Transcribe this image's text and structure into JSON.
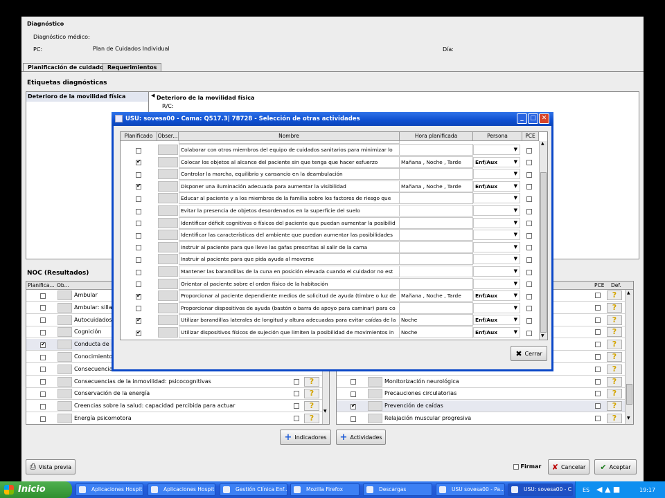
{
  "header": {
    "section_title": "Diagnóstico",
    "diag_medico_label": "Diagnóstico médico:",
    "pc_label": "PC:",
    "pc_value": "Plan de Cuidados Individual",
    "dia_label": "Día:"
  },
  "tabs": [
    "Planificación de cuidados",
    "Requerimientos"
  ],
  "etiquetas": {
    "title": "Etiquetas diagnósticas",
    "list_item": "Deterioro de la movilidad física",
    "detail_title": "Deterioro de la movilidad física",
    "detail_rc": "R/C:"
  },
  "noc": {
    "title": "NOC (Resultados)",
    "headers": [
      "Planifica...",
      "Ob..."
    ],
    "rows": [
      {
        "checked": false,
        "name": "Ambular"
      },
      {
        "checked": false,
        "name": "Ambular: silla d"
      },
      {
        "checked": false,
        "name": "Autocuidados:"
      },
      {
        "checked": false,
        "name": "Cognición"
      },
      {
        "checked": true,
        "name": "Conducta de p"
      },
      {
        "checked": false,
        "name": "Conocimiento:"
      },
      {
        "checked": false,
        "name": "Consecuencia"
      },
      {
        "checked": false,
        "name": "Consecuencias de la inmovilidad: psicocognitivas"
      },
      {
        "checked": false,
        "name": "Conservación de la energía"
      },
      {
        "checked": false,
        "name": "Creencias sobre la salud: capacidad percibida para actuar"
      },
      {
        "checked": false,
        "name": "Energía psicomotora"
      }
    ]
  },
  "nic": {
    "headers": [
      "PCE",
      "Def."
    ],
    "rows": [
      {
        "checked": false,
        "name": "Monitorización neurológica"
      },
      {
        "checked": false,
        "name": "Precauciones circulatorias"
      },
      {
        "checked": true,
        "name": "Prevención de caídas"
      },
      {
        "checked": false,
        "name": "Relajación muscular progresiva"
      }
    ]
  },
  "buttons": {
    "indicadores": "Indicadores",
    "actividades": "Actividades",
    "vista_previa": "Vista previa",
    "firmar": "Firmar",
    "cancelar": "Cancelar",
    "aceptar": "Aceptar"
  },
  "dialog": {
    "title": "USU: sovesa00 - Cama: Q517.3| 78728 - Selección de otras actividades",
    "headers": [
      "Planificado",
      "Obser...",
      "Nombre",
      "Hora planificada",
      "Persona",
      "PCE"
    ],
    "rows": [
      {
        "checked": false,
        "name": "Colaborar con otros miembros del equipo de cuidados sanitarios para minimizar lo",
        "hora": "",
        "persona": ""
      },
      {
        "checked": true,
        "name": "Colocar los objetos al alcance del paciente sin que tenga que hacer esfuerzo",
        "hora": "Mañana , Noche , Tarde",
        "persona": "Enf/Aux"
      },
      {
        "checked": false,
        "name": "Controlar la marcha, equilibrio y cansancio en la deambulación",
        "hora": "",
        "persona": ""
      },
      {
        "checked": true,
        "name": "Disponer una iluminación adecuada para aumentar la visibilidad",
        "hora": "Mañana , Noche , Tarde",
        "persona": "Enf/Aux"
      },
      {
        "checked": false,
        "name": "Educar al paciente y a los miembros de la familia sobre los factores de riesgo que",
        "hora": "",
        "persona": ""
      },
      {
        "checked": false,
        "name": "Evitar la presencia de objetos desordenados en la superficie del suelo",
        "hora": "",
        "persona": ""
      },
      {
        "checked": false,
        "name": "Identificar déficit cognitivos o físicos del paciente que puedan aumentar la posibilid",
        "hora": "",
        "persona": ""
      },
      {
        "checked": false,
        "name": "Identificar las características del ambiente que puedan aumentar las posibilidades",
        "hora": "",
        "persona": ""
      },
      {
        "checked": false,
        "name": "Instruir al paciente para que lleve las gafas prescritas al salir de la cama",
        "hora": "",
        "persona": ""
      },
      {
        "checked": false,
        "name": "Instruir al paciente para que pida ayuda al moverse",
        "hora": "",
        "persona": ""
      },
      {
        "checked": false,
        "name": "Mantener las barandillas de la cuna en posición elevada cuando el cuidador no est",
        "hora": "",
        "persona": ""
      },
      {
        "checked": false,
        "name": "Orientar al paciente sobre el orden físico de la habitación",
        "hora": "",
        "persona": ""
      },
      {
        "checked": true,
        "name": "Proporcionar al paciente dependiente medios de solicitud de ayuda (timbre o luz de",
        "hora": "Mañana , Noche , Tarde",
        "persona": "Enf/Aux"
      },
      {
        "checked": false,
        "name": "Proporcionar dispositivos de ayuda (bastón o barra de apoyo para caminar) para co",
        "hora": "",
        "persona": ""
      },
      {
        "checked": true,
        "name": "Utilizar barandillas laterales de longitud y altura adecuadas para evitar caídas de la",
        "hora": "Noche",
        "persona": "Enf/Aux"
      },
      {
        "checked": true,
        "name": "Utilizar dispositivos físicos de sujeción que limiten la posibilidad de movimientos in",
        "hora": "Noche",
        "persona": "Enf/Aux"
      }
    ],
    "close_button": "Cerrar"
  },
  "taskbar": {
    "start": "Inicio",
    "items": [
      "Aplicaciones Hospit...",
      "Aplicaciones Hospit...",
      "Gestión Clínica Enf...",
      "Mozilla Firefox",
      "Descargas",
      "USU sovesa00 - Pa...",
      "USU: sovesa00 - C..."
    ],
    "lang": "ES",
    "clock": "19:17"
  }
}
